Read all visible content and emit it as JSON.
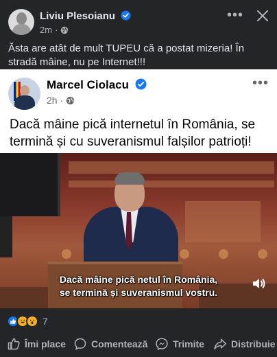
{
  "outer_post": {
    "author": "Liviu Plesoianu",
    "time": "2m",
    "text": "Ăsta are atât de mult TUPEU că a postat mizeria! În stradă mâine, nu pe Internet!!!"
  },
  "shared_post": {
    "author": "Marcel Ciolacu",
    "time": "2h",
    "text": "Dacă mâine pică internetul în România, se termină și cu suveranismul falșilor patrioți!",
    "video_subtitle_line1": "Dacă mâine pică netul în România,",
    "video_subtitle_line2": "se termină și suveranismul vostru."
  },
  "reactions": {
    "count": "7",
    "types": [
      "like",
      "haha",
      "wow"
    ]
  },
  "actions": {
    "like": "Îmi place",
    "comment": "Comentează",
    "send": "Trimite",
    "share": "Distribuie"
  },
  "colors": {
    "background": "#242526",
    "text": "#e4e6eb",
    "secondary_text": "#b0b3b8",
    "verified_blue": "#1877f2",
    "card": "#ffffff"
  },
  "icons": [
    "verified-badge-icon",
    "globe-icon",
    "more-icon",
    "close-icon",
    "sound-icon",
    "like-icon",
    "comment-icon",
    "messenger-icon",
    "share-icon"
  ]
}
